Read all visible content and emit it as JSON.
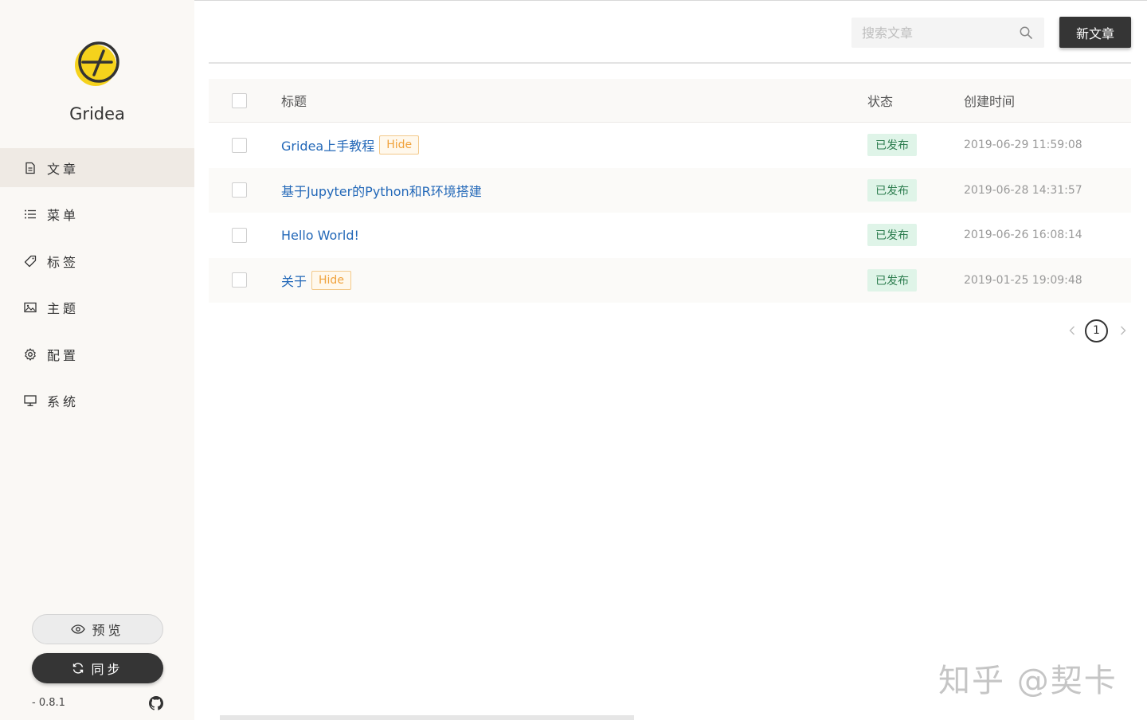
{
  "app": {
    "name": "Gridea",
    "version": "- 0.8.1"
  },
  "sidebar": {
    "items": [
      {
        "label": "文章",
        "icon": "file-text-icon",
        "active": true
      },
      {
        "label": "菜单",
        "icon": "list-icon",
        "active": false
      },
      {
        "label": "标签",
        "icon": "tag-icon",
        "active": false
      },
      {
        "label": "主题",
        "icon": "image-icon",
        "active": false
      },
      {
        "label": "配置",
        "icon": "gear-icon",
        "active": false
      },
      {
        "label": "系统",
        "icon": "monitor-icon",
        "active": false
      }
    ],
    "preview_label": "预览",
    "sync_label": "同步"
  },
  "header": {
    "search_placeholder": "搜索文章",
    "new_post_label": "新文章"
  },
  "table": {
    "columns": {
      "title": "标题",
      "status": "状态",
      "created": "创建时间"
    },
    "rows": [
      {
        "title": "Gridea上手教程",
        "hidden_tag": "Hide",
        "status": "已发布",
        "created": "2019-06-29 11:59:08"
      },
      {
        "title": "基于Jupyter的Python和R环境搭建",
        "hidden_tag": "",
        "status": "已发布",
        "created": "2019-06-28 14:31:57"
      },
      {
        "title": "Hello World!",
        "hidden_tag": "",
        "status": "已发布",
        "created": "2019-06-26 16:08:14"
      },
      {
        "title": "关于",
        "hidden_tag": "Hide",
        "status": "已发布",
        "created": "2019-01-25 19:09:48"
      }
    ]
  },
  "pagination": {
    "current": "1"
  },
  "watermark": "知乎 @契卡",
  "colors": {
    "accent_dark": "#353535",
    "link": "#2368b8",
    "published_bg": "#dff4e8",
    "hide_tag": "#f0a23c",
    "logo_yellow": "#f5d21c"
  }
}
